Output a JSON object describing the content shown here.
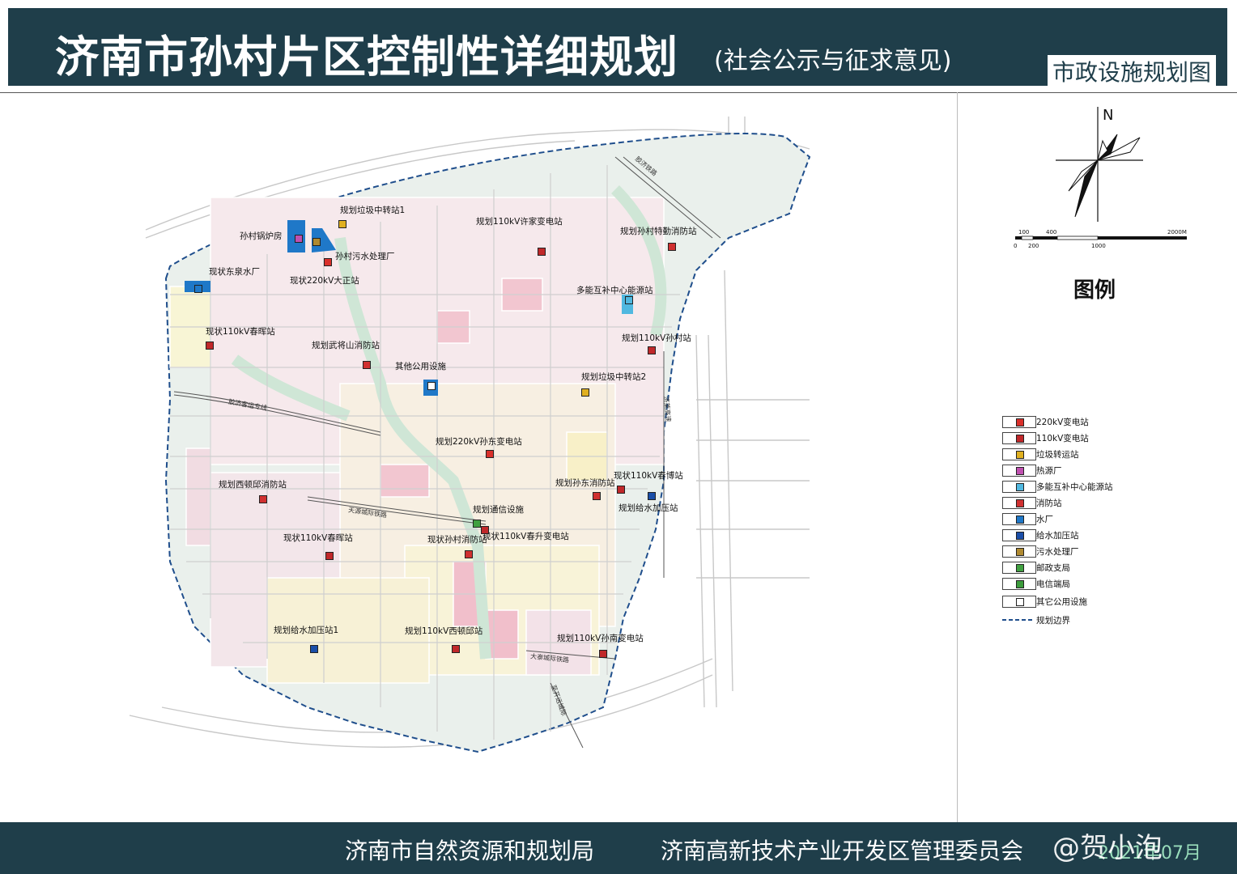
{
  "header": {
    "title": "济南市孙村片区控制性详细规划",
    "subtitle": "(社会公示与征求意见)",
    "sheet_title": "市政设施规划图"
  },
  "footer": {
    "left_org": "济南市自然资源和规划局",
    "right_org": "济南高新技术产业开发区管理委员会",
    "date": "2021年07月",
    "watermark": "@贺小泡"
  },
  "north_arrow": {
    "label": "N"
  },
  "scale_bar": {
    "ticks": [
      "0",
      "100",
      "200",
      "400",
      "1000",
      "2000M"
    ]
  },
  "legend": {
    "title": "图例",
    "items": [
      {
        "label": "220kV变电站",
        "color": "#d9302b"
      },
      {
        "label": "110kV变电站",
        "color": "#c0282a"
      },
      {
        "label": "垃圾转运站",
        "color": "#e0b020"
      },
      {
        "label": "热源厂",
        "color": "#c050b0"
      },
      {
        "label": "多能互补中心能源站",
        "color": "#50b8e0"
      },
      {
        "label": "消防站",
        "color": "#d03030"
      },
      {
        "label": "水厂",
        "color": "#1f78c8"
      },
      {
        "label": "给水加压站",
        "color": "#1a4ea8"
      },
      {
        "label": "污水处理厂",
        "color": "#b08a30"
      },
      {
        "label": "邮政支局",
        "color": "#40a040"
      },
      {
        "label": "电信端局",
        "color": "#3c9c3c"
      },
      {
        "label": "其它公用设施",
        "color": "#ffffff"
      },
      {
        "label": "规划边界",
        "color": "#1f4e8c"
      }
    ]
  },
  "facilities": [
    {
      "label": "规划垃圾中转站1",
      "color": "#e0b020"
    },
    {
      "label": "规划110kV许家变电站",
      "color": "#c0282a"
    },
    {
      "label": "规划孙村特勤消防站",
      "color": "#d03030"
    },
    {
      "label": "孙村锅炉房",
      "color": "#c050b0"
    },
    {
      "label": "孙村污水处理厂",
      "color": "#b08a30"
    },
    {
      "label": "现状东泉水厂",
      "color": "#1f78c8"
    },
    {
      "label": "现状220kV大正站",
      "color": "#d9302b"
    },
    {
      "label": "多能互补中心能源站",
      "color": "#50b8e0"
    },
    {
      "label": "现状110kV春晖站",
      "color": "#c0282a"
    },
    {
      "label": "规划110kV孙村站",
      "color": "#c0282a"
    },
    {
      "label": "规划武将山消防站",
      "color": "#d03030"
    },
    {
      "label": "其他公用设施",
      "color": "#ffffff"
    },
    {
      "label": "规划垃圾中转站2",
      "color": "#e0b020"
    },
    {
      "label": "规划220kV孙东变电站",
      "color": "#d9302b"
    },
    {
      "label": "规划西顿邱消防站",
      "color": "#d03030"
    },
    {
      "label": "规划孙东消防站",
      "color": "#d03030"
    },
    {
      "label": "现状110kV春博站",
      "color": "#c0282a"
    },
    {
      "label": "规划给水加压站",
      "color": "#1a4ea8"
    },
    {
      "label": "规划通信设施",
      "color": "#40a040"
    },
    {
      "label": "现状110kV春晖站",
      "color": "#c0282a"
    },
    {
      "label": "现状孙村消防站",
      "color": "#d03030"
    },
    {
      "label": "现状110kV春升变电站",
      "color": "#c0282a"
    },
    {
      "label": "规划给水加压站1",
      "color": "#1a4ea8"
    },
    {
      "label": "规划110kV西顿邱站",
      "color": "#c0282a"
    },
    {
      "label": "规划110kV孙南变电站",
      "color": "#c0282a"
    }
  ],
  "road_labels": [
    "胶济客运专线",
    "天源城际铁路",
    "胶济铁路",
    "济莱高速",
    "大泰城际铁路",
    "至开远城际"
  ]
}
